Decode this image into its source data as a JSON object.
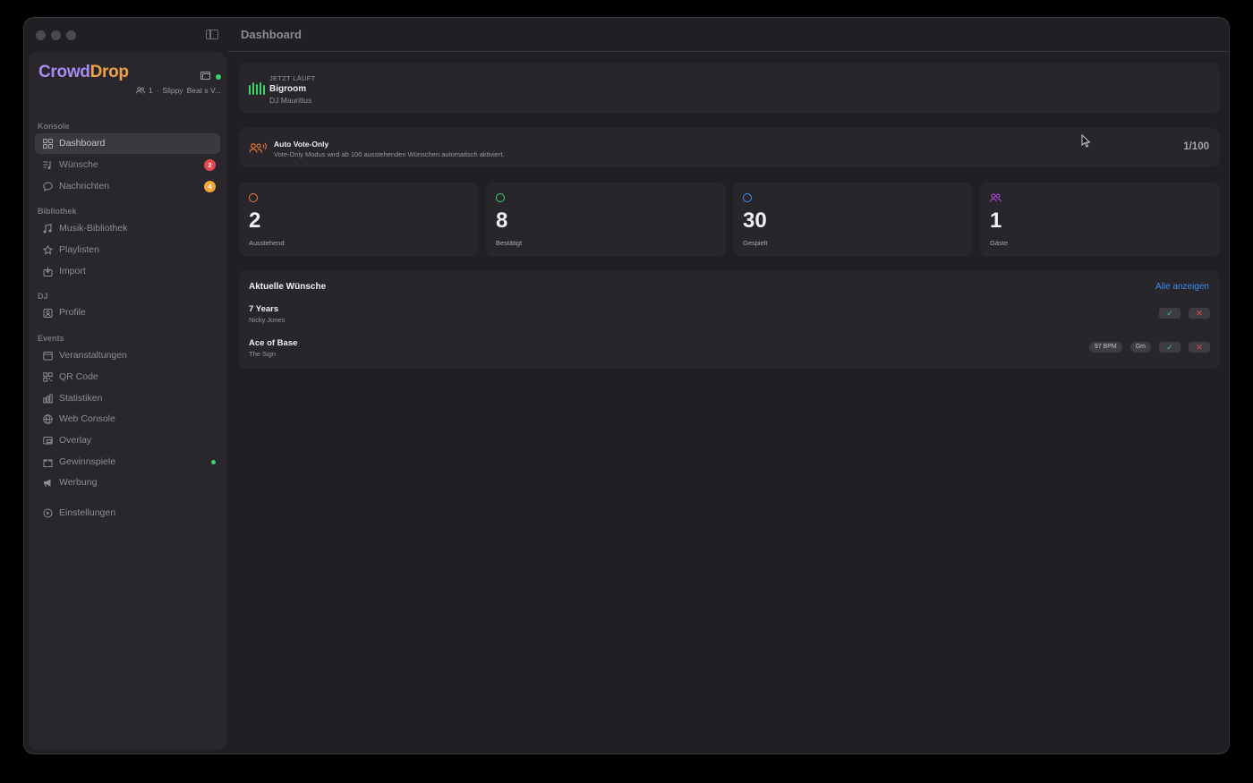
{
  "window": {
    "title": "Dashboard"
  },
  "brand": {
    "part1": "Crowd",
    "part2": "Drop",
    "meta_count": "1",
    "meta_sep": "·",
    "meta_user": "Slippy",
    "meta_event": "Beat s V..."
  },
  "sidebar": {
    "sections": {
      "konsole": "Konsole",
      "bibliothek": "Bibliothek",
      "dj": "DJ",
      "events": "Events"
    },
    "items": {
      "dashboard": "Dashboard",
      "wuensche": "Wünsche",
      "wuensche_badge": "2",
      "nachrichten": "Nachrichten",
      "nachrichten_badge": "4",
      "musik": "Musik-Bibliothek",
      "playlisten": "Playlisten",
      "import": "Import",
      "profile": "Profile",
      "veranstaltungen": "Veranstaltungen",
      "qrcode": "QR Code",
      "statistiken": "Statistiken",
      "webconsole": "Web Console",
      "overlay": "Overlay",
      "gewinnspiele": "Gewinnspiele",
      "werbung": "Werbung",
      "einstellungen": "Einstellungen"
    }
  },
  "now_playing": {
    "label": "JETZT LÄUFT",
    "title": "Bigroom",
    "artist": "DJ Mauritius"
  },
  "vote_only": {
    "title": "Auto Vote-Only",
    "subtitle": "Vote-Only Modus wird ab 100 ausstehenden Wünschen automatisch aktiviert.",
    "count": "1/100"
  },
  "stats": [
    {
      "value": "2",
      "label": "Ausstehend",
      "color": "#f0813a"
    },
    {
      "value": "8",
      "label": "Bestätigt",
      "color": "#3ad66a"
    },
    {
      "value": "30",
      "label": "Gespielt",
      "color": "#3a8ef6"
    },
    {
      "value": "1",
      "label": "Gäste",
      "color": "#b04ae0"
    }
  ],
  "recent": {
    "title": "Aktuelle Wünsche",
    "show_all": "Alle anzeigen",
    "requests": [
      {
        "title": "7 Years",
        "artist": "Nicky Jones"
      },
      {
        "title": "Ace of Base",
        "artist": "The Sign",
        "bpm": "97 BPM",
        "key": "Gm"
      }
    ],
    "accept_icon": "✓",
    "reject_icon": "✕"
  }
}
